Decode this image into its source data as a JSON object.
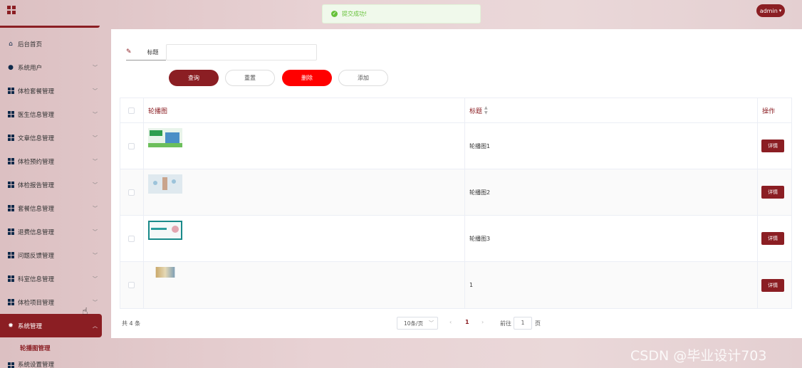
{
  "header": {
    "toast": "提交成功!",
    "user": "admin"
  },
  "sidebar": {
    "items": [
      {
        "label": "后台首页",
        "icon": "home-icon",
        "arrow": false
      },
      {
        "label": "系统用户",
        "icon": "user-icon",
        "arrow": true
      },
      {
        "label": "体检套餐管理",
        "icon": "grid-icon",
        "arrow": true
      },
      {
        "label": "医生信息管理",
        "icon": "grid-icon",
        "arrow": true
      },
      {
        "label": "文章信息管理",
        "icon": "grid-icon",
        "arrow": true
      },
      {
        "label": "体检预约管理",
        "icon": "grid-icon",
        "arrow": true
      },
      {
        "label": "体检报告管理",
        "icon": "grid-icon",
        "arrow": true
      },
      {
        "label": "套餐信息管理",
        "icon": "grid-icon",
        "arrow": true
      },
      {
        "label": "退费信息管理",
        "icon": "grid-icon",
        "arrow": true
      },
      {
        "label": "问题反馈管理",
        "icon": "grid-icon",
        "arrow": true
      },
      {
        "label": "科室信息管理",
        "icon": "grid-icon",
        "arrow": true
      },
      {
        "label": "体检项目管理",
        "icon": "grid-icon",
        "arrow": true
      }
    ],
    "active": {
      "label": "系统管理",
      "icon": "gear-icon"
    },
    "sub_item": "轮播图管理",
    "cut_item": "系统设置管理"
  },
  "search": {
    "label": "标题",
    "value": "",
    "placeholder": ""
  },
  "actions": {
    "query": "查询",
    "reset": "重置",
    "delete": "删除",
    "add": "添加"
  },
  "table": {
    "headers": {
      "image": "轮播图",
      "title": "标题",
      "ops": "操作"
    },
    "rows": [
      {
        "title": "轮播图1",
        "detail": "详情"
      },
      {
        "title": "轮播图2",
        "detail": "详情"
      },
      {
        "title": "轮播图3",
        "detail": "详情"
      },
      {
        "title": "1",
        "detail": "详情"
      }
    ]
  },
  "pagination": {
    "total": "共 4 条",
    "page_size": "10条/页",
    "current_page": "1",
    "goto_label": "前往",
    "goto_value": "1",
    "goto_suffix": "页"
  },
  "watermark": "CSDN @毕业设计703",
  "colors": {
    "primary": "#8b1e23",
    "danger": "#ff0000",
    "success": "#67c23a"
  }
}
